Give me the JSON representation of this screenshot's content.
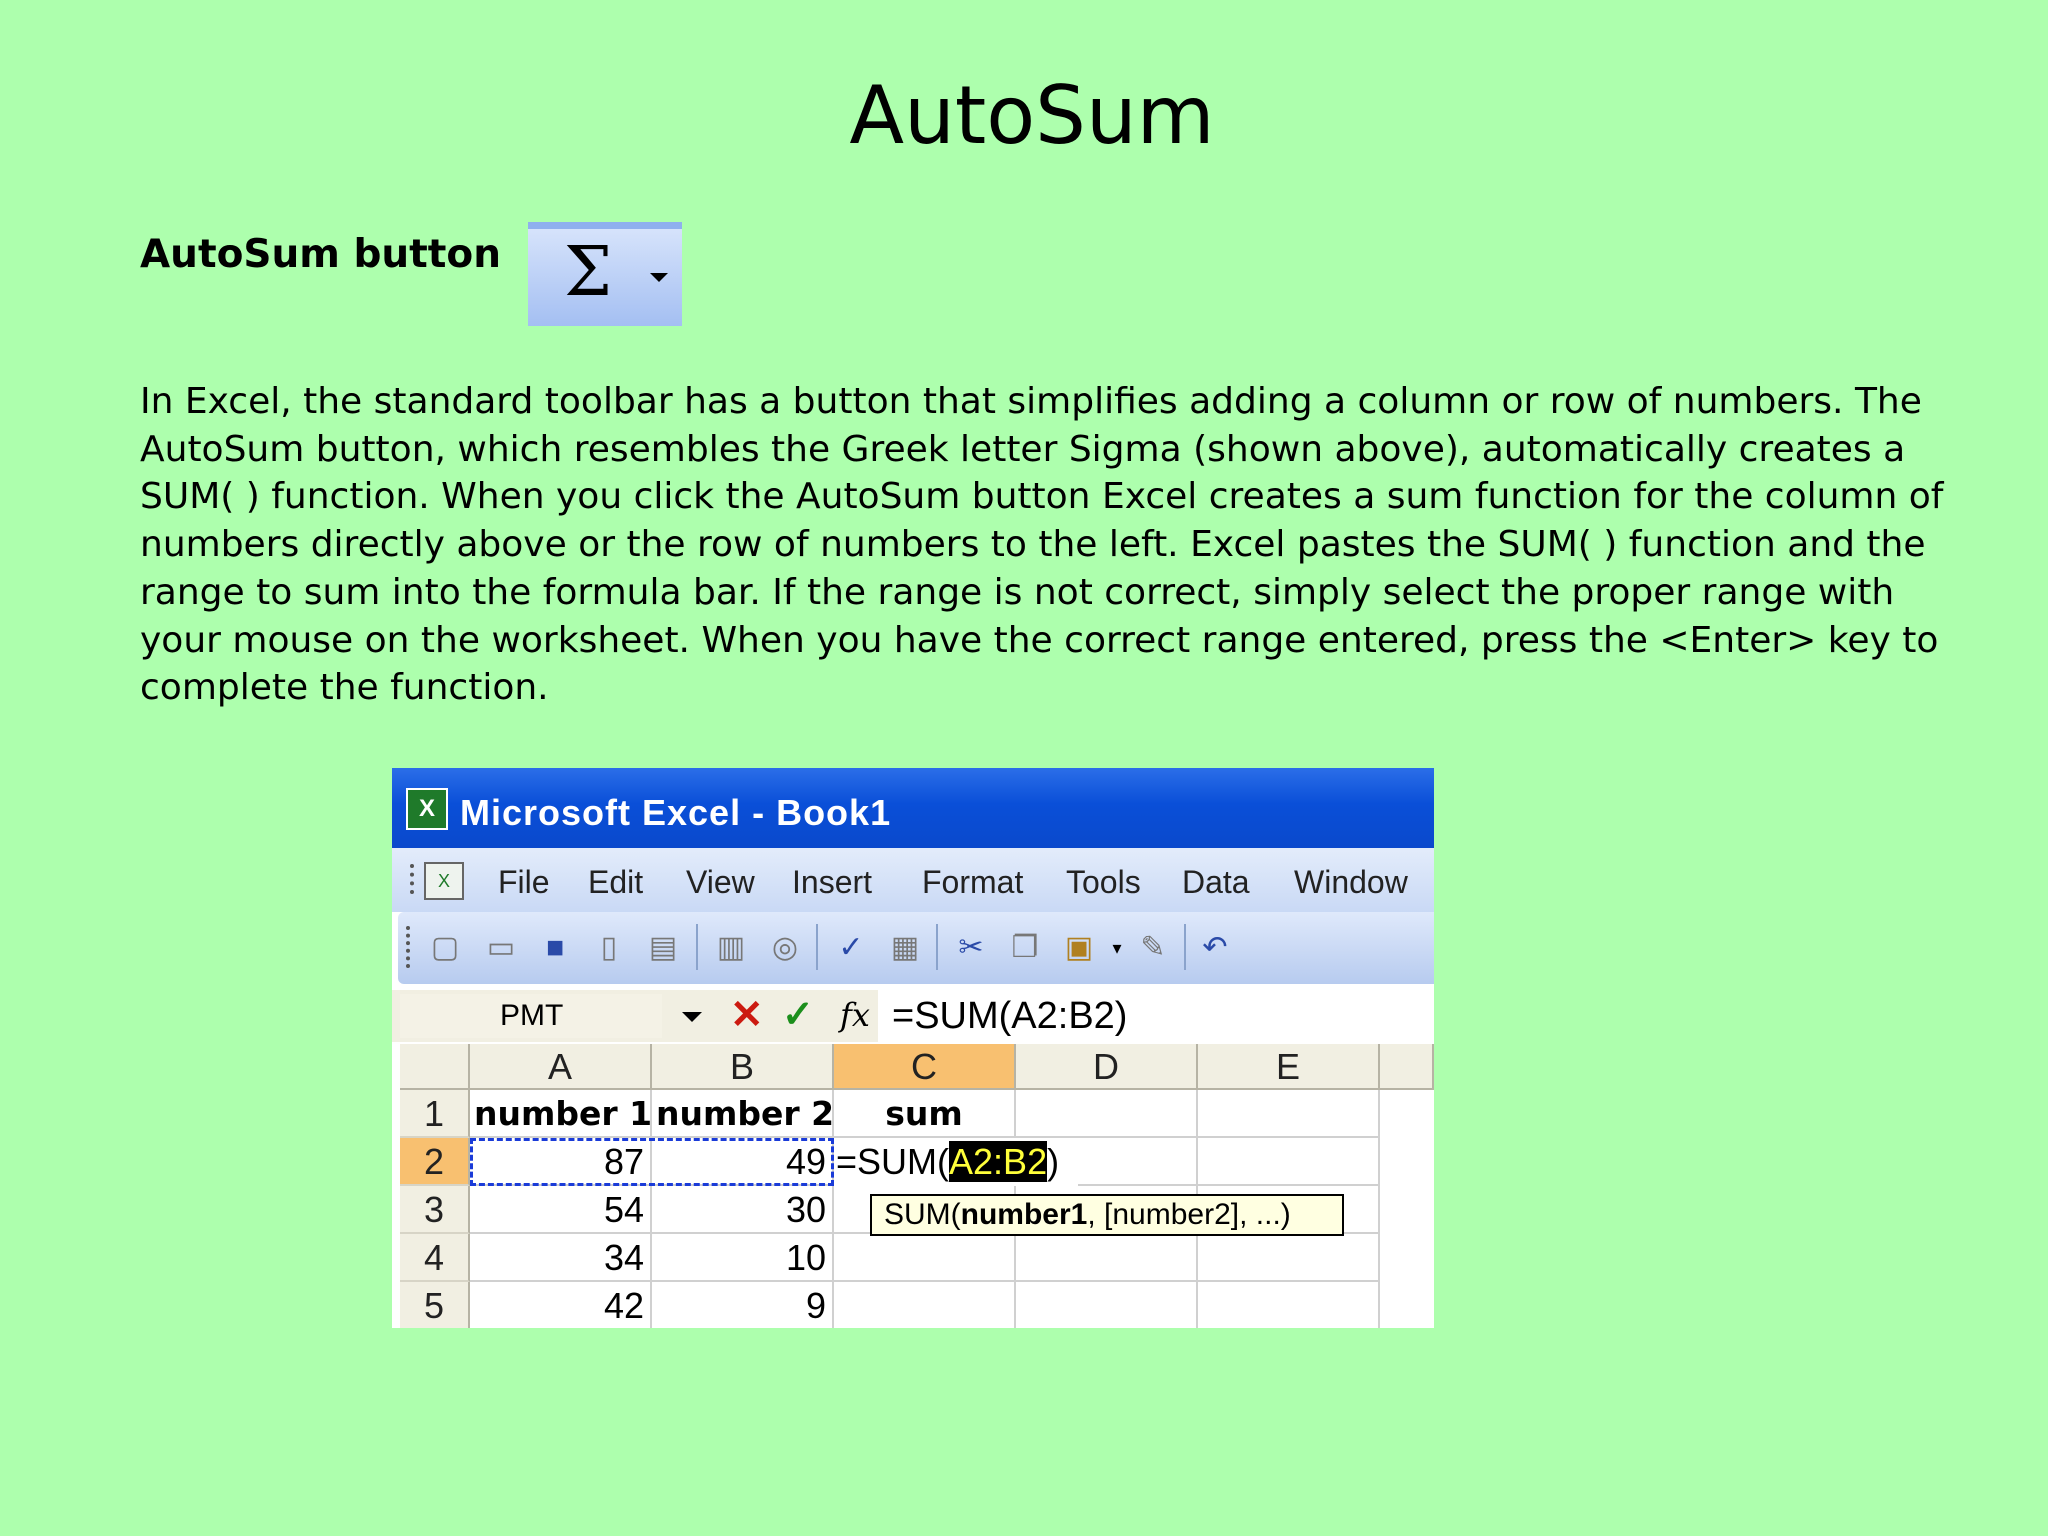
{
  "slide": {
    "title": "AutoSum",
    "button_label": "AutoSum button",
    "sigma_symbol": "Σ",
    "paragraph_lines": [
      "In Excel, the standard toolbar has a button that simplifies adding a column or row of numbers. The",
      "AutoSum button, which resembles the Greek letter Sigma (shown above), automatically creates a",
      "SUM( ) function. When you click the AutoSum button Excel creates a sum function for the column of",
      "numbers directly above or the row of numbers to the left. Excel pastes the SUM( ) function and the",
      "range to sum into the formula bar. If the range is not correct, simply select the proper range with",
      "your mouse on the worksheet. When you have the correct range entered, press the <Enter> key to",
      "complete the function."
    ]
  },
  "excel": {
    "window_title": "Microsoft Excel - Book1",
    "menu": [
      "File",
      "Edit",
      "View",
      "Insert",
      "Format",
      "Tools",
      "Data",
      "Window"
    ],
    "name_box": "PMT",
    "formula": "=SUM(A2:B2)",
    "columns": [
      "A",
      "B",
      "C",
      "D",
      "E"
    ],
    "rows": [
      "1",
      "2",
      "3",
      "4",
      "5"
    ],
    "cells": {
      "a1": "number 1",
      "b1": "number 2",
      "c1": "sum",
      "a2": "87",
      "b2": "49",
      "a3": "54",
      "b3": "30",
      "a4": "34",
      "b4": "10",
      "a5": "42",
      "b5": "9"
    },
    "cell_formula_prefix": "=SUM(",
    "cell_formula_range": "A2:B2",
    "cell_formula_suffix": ")",
    "tooltip_prefix": "SUM(",
    "tooltip_bold": "number1",
    "tooltip_rest": ", [number2], ...)",
    "colors": {
      "title_bar": "#0a4fd8",
      "active_header": "#f8c070",
      "slide_bg": "#adffad"
    }
  }
}
